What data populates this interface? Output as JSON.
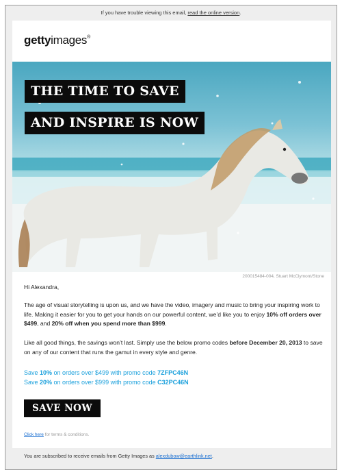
{
  "top_notice": {
    "text": "If you have trouble viewing this email, ",
    "link": "read the online version",
    "suffix": "."
  },
  "brand": {
    "logo_bold": "getty",
    "logo_light": "images",
    "logo_mark": "®"
  },
  "hero": {
    "headline_line1": "THE TIME TO SAVE",
    "headline_line2": "AND INSPIRE IS NOW",
    "credit": "200015484-004, Stuart McClymont/Stone"
  },
  "message": {
    "greeting": "Hi Alexandra,",
    "p1_a": "The age of visual storytelling is upon us, and we have the video, imagery and music to bring your inspiring work to life. Making it easier for you to get your hands on our powerful content, we’d like you to enjoy ",
    "p1_b": "10% off orders over $499",
    "p1_c": ", and ",
    "p1_d": "20% off when you spend more than $999",
    "p1_e": ".",
    "p2_a": "Like all good things, the savings won’t last. Simply use the below promo codes ",
    "p2_b": "before December 20, 2013",
    "p2_c": " to save on any of our content that runs the gamut in every style and genre."
  },
  "promos": [
    {
      "pre": "Save ",
      "pct": "10%",
      "mid": " on orders over $499 with promo code ",
      "code": "7ZFPC46N"
    },
    {
      "pre": "Save ",
      "pct": "20%",
      "mid": " on orders over $999 with promo code ",
      "code": "C32PC46N"
    }
  ],
  "cta": {
    "label": "SAVE NOW"
  },
  "terms": {
    "link": "Click here",
    "text": " for terms & conditions."
  },
  "footer": {
    "text": "You are subscribed to receive emails from Getty Images as ",
    "email": "alexdubow@earthlink.net",
    "suffix": "."
  },
  "colors": {
    "accent_blue": "#1aa0dc",
    "link_blue": "#1a6fd1",
    "banner_black": "#0b0b0b"
  }
}
